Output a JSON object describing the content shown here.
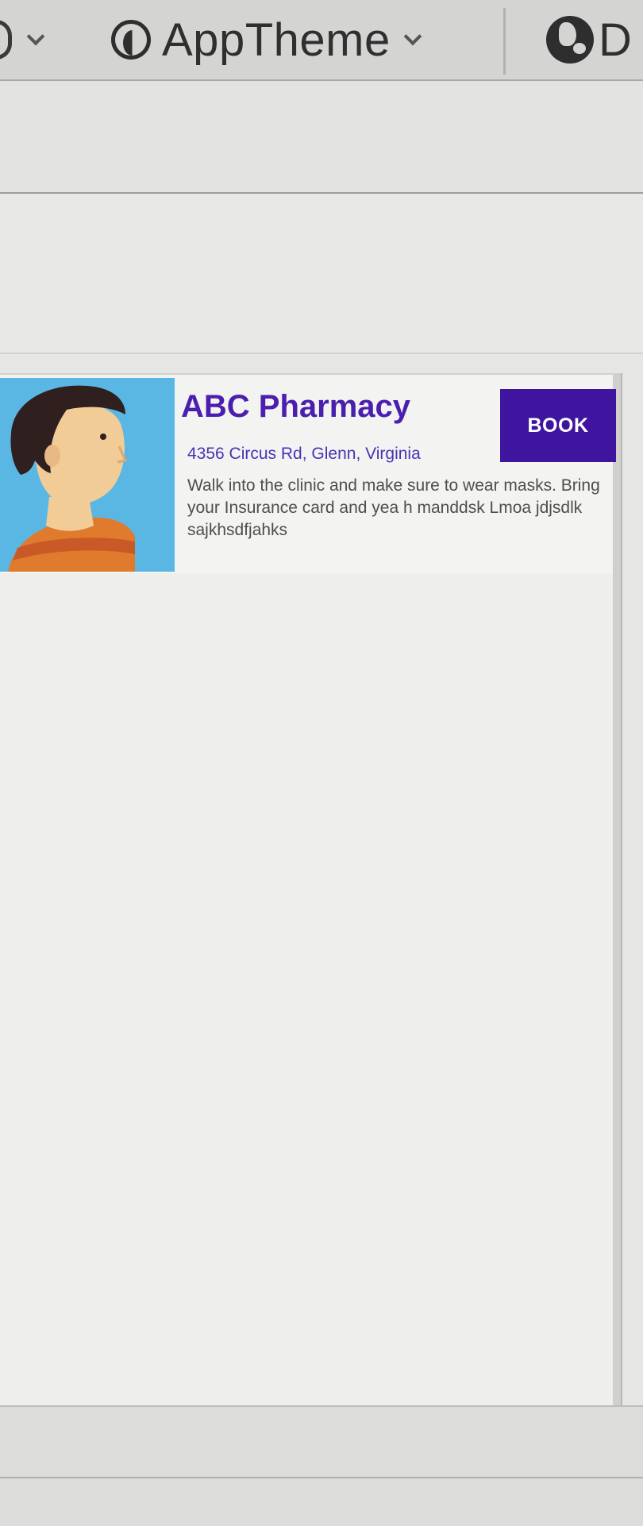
{
  "toolbar": {
    "theme_label": "AppTheme",
    "locale_label": "D",
    "theme_icon": "theme-icon",
    "locale_icon": "globe-icon"
  },
  "card": {
    "name": "ABC Pharmacy",
    "address": "4356 Circus Rd, Glenn, Virginia",
    "description": "Walk into the clinic and make sure to wear masks. Bring your Insurance card and yea h manddsk Lmoa jdjsdlk sajkhsdfjahks",
    "book_label": "BOOK",
    "accent_color": "#4a1fb0",
    "button_color": "#3f149e",
    "avatar_background": "#5ab7e3"
  }
}
